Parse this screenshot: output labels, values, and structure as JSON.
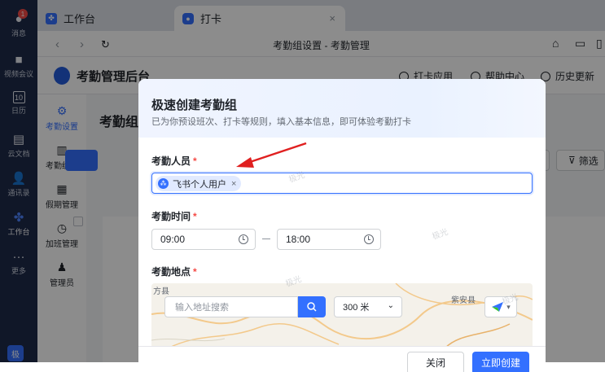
{
  "rail": {
    "items": [
      {
        "label": "消息",
        "icon": "chat-icon",
        "badge": "1"
      },
      {
        "label": "视频会议",
        "icon": "video-icon"
      },
      {
        "label": "日历",
        "icon": "calendar-icon",
        "day": "10"
      },
      {
        "label": "云文档",
        "icon": "doc-icon"
      },
      {
        "label": "通讯录",
        "icon": "contacts-icon"
      },
      {
        "label": "工作台",
        "icon": "workbench-icon"
      },
      {
        "label": "更多",
        "icon": "more-icon"
      }
    ],
    "avatar_text": "极"
  },
  "tabs": [
    {
      "label": "工作台",
      "active": false
    },
    {
      "label": "打卡",
      "active": true,
      "close": "×"
    }
  ],
  "address_bar": {
    "title": "考勤组设置 - 考勤管理"
  },
  "page": {
    "brand": "考勤管理后台",
    "header_links": [
      "打卡应用",
      "帮助中心",
      "历史更新"
    ],
    "sidenav": [
      {
        "label": "考勤设置",
        "icon": "gear-icon",
        "active": true
      },
      {
        "label": "考勤统计",
        "icon": "bar-chart-icon"
      },
      {
        "label": "假期管理",
        "icon": "calendar-icon"
      },
      {
        "label": "加班管理",
        "icon": "clock-icon"
      },
      {
        "label": "管理员",
        "icon": "user-icon"
      }
    ],
    "main_title": "考勤组",
    "filter_label": "筛选"
  },
  "modal": {
    "title": "极速创建考勤组",
    "subtitle": "已为你预设班次、打卡等规则，填入基本信息，即可体验考勤打卡",
    "members_label": "考勤人员",
    "member_chip": "飞书个人用户",
    "time_label": "考勤时间",
    "start_time": "09:00",
    "end_time": "18:00",
    "location_label": "考勤地点",
    "address_placeholder": "输入地址搜索",
    "radius": "300 米",
    "map_labels": [
      "方县",
      "紫安县"
    ],
    "cancel": "关闭",
    "create": "立即创建"
  },
  "watermark": "极光",
  "colors": {
    "accent": "#3370ff",
    "rail": "#1e2a4a",
    "required": "#f54a45",
    "arrow": "#e02020"
  }
}
